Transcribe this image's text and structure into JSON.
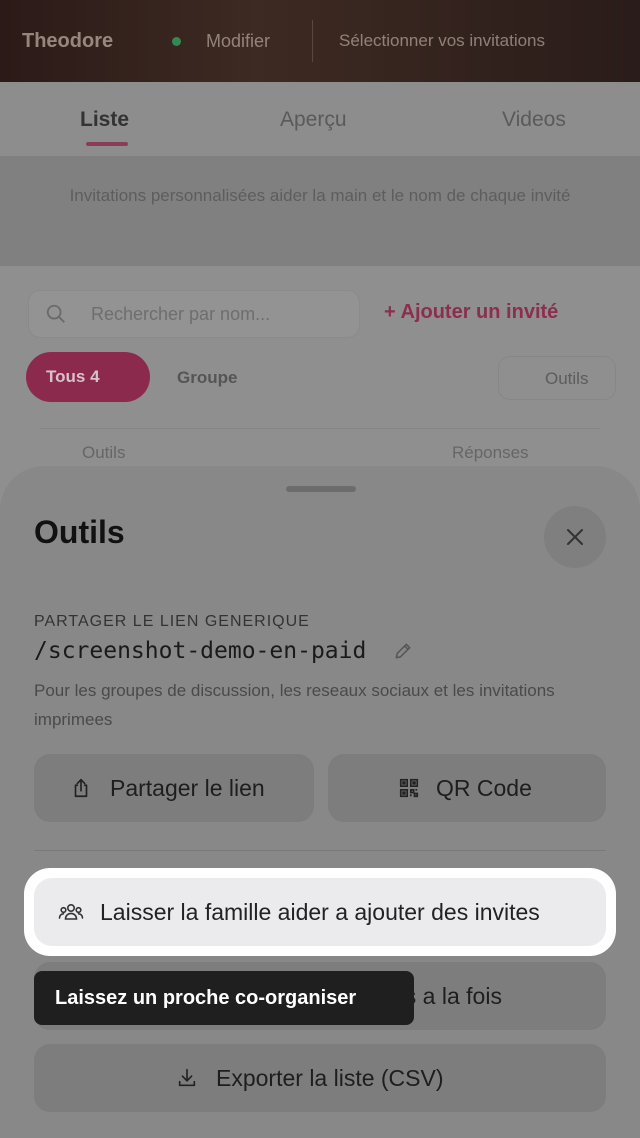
{
  "header": {
    "user_name": "Theodore",
    "edit_label": "Modifier",
    "select_guests_label": "Sélectionner vos invitations"
  },
  "tabs": [
    {
      "label": "Liste"
    },
    {
      "label": "Aperçu"
    },
    {
      "label": "Videos"
    }
  ],
  "notice_text": "Invitations personnalisées aider la main et le nom de chaque invité",
  "search": {
    "placeholder": "Rechercher par nom..."
  },
  "add_guest_label": "+ Ajouter un invité",
  "filters": {
    "all_label": "Tous 4",
    "group_label": "Groupe",
    "tools_label": "Outils"
  },
  "table": {
    "col_tools": "Outils",
    "col_response": "Réponses"
  },
  "sheet": {
    "title": "Outils",
    "share_section_label": "PARTAGER LE LIEN GENERIQUE",
    "link_path": "/screenshot-demo-en-paid",
    "share_description": "Pour les groupes de discussion, les reseaux sociaux et les invitations imprimees",
    "share_button_label": "Partager le lien",
    "qr_button_label": "QR Code",
    "family_button_label": "Laisser la famille aider a ajouter des invites",
    "bulk_button_label": "es a la fois",
    "export_button_label": "Exporter la liste (CSV)",
    "tooltip_text": "Laissez un proche co-organiser"
  },
  "icons": {
    "close": "close-icon",
    "pencil": "pencil-icon",
    "share": "share-icon",
    "qr": "qr-code-icon",
    "family": "people-icon",
    "export": "download-icon",
    "search": "search-icon"
  },
  "colors": {
    "accent": "#E0306A",
    "tooltip_bg": "#1F1F1F",
    "spotlight_bg": "#FFFFFF"
  }
}
